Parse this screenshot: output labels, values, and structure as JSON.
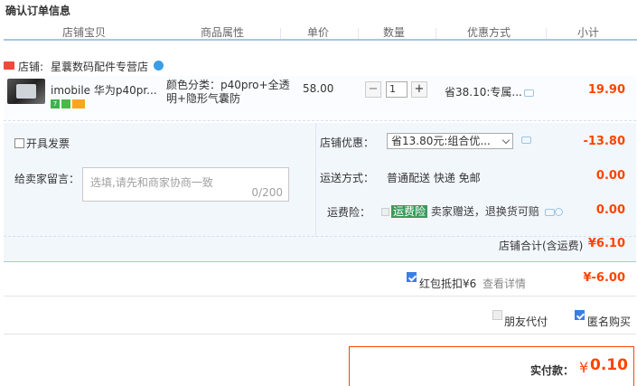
{
  "page_title": "确认订单信息",
  "columns": [
    "店铺宝贝",
    "商品属性",
    "单价",
    "数量",
    "优惠方式",
    "小计"
  ],
  "shop": {
    "label": "店铺:",
    "name": "星蘘数码配件专营店"
  },
  "item": {
    "name": "imobile 华为p40pr...",
    "attributes": "颜色分类：p40pro+全透明+隐形气囊防",
    "unit_price": "58.00",
    "quantity": "1",
    "promotion": "省38.10:专属...",
    "subtotal": "19.90"
  },
  "options": {
    "invoice_label": "开具发票",
    "message_label": "给卖家留言：",
    "message_placeholder": "选填,请先和商家协商一致",
    "message_count": "0/200",
    "shop_discount_label": "店铺优惠：",
    "shop_discount_value": "省13.80元:组合优...",
    "shop_discount_amount": "-13.80",
    "shipping_label": "运送方式：",
    "shipping_value": "普通配送 快递 免邮",
    "shipping_amount": "0.00",
    "insurance_label": "运费险：",
    "insurance_tag": "运费险",
    "insurance_text": "卖家赠送，退换货可赔",
    "insurance_amount": "0.00"
  },
  "shop_total": {
    "label": "店铺合计(含运费)",
    "value": "¥6.10"
  },
  "red_packet": {
    "label": "红包抵扣¥6",
    "link": "查看详情",
    "checked": true,
    "value": "¥-6.00"
  },
  "buy_options": {
    "friend_pay": "朋友代付",
    "friend_pay_checked": false,
    "anonymous": "匿名购买",
    "anonymous_checked": true
  },
  "payment": {
    "label": "实付款：",
    "currency": "¥",
    "amount": "0.10"
  },
  "colors": {
    "accent": "#ff4400",
    "header_border": "#a8c5e5",
    "panel_bg": "#f2f7fc",
    "insurance_tag": "#3a9b5c",
    "checkbox": "#3a7ee6"
  }
}
